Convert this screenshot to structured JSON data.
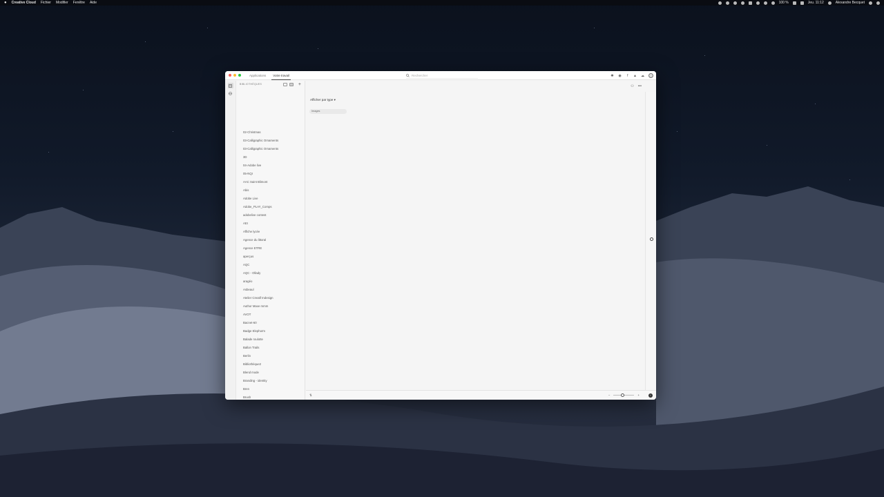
{
  "menubar": {
    "apple": "",
    "app_name": "Creative Cloud",
    "menus": [
      "Fichier",
      "Modifier",
      "Fenêtre",
      "Aide"
    ],
    "battery": "100 %",
    "datetime": "Jeu. 11:12",
    "user": "Alexandre Becquet"
  },
  "window": {
    "tabs": [
      {
        "label": "Applications",
        "active": false
      },
      {
        "label": "Votre travail",
        "active": true
      }
    ],
    "search": {
      "placeholder": "Rechercher"
    },
    "toolbar_icons": [
      "gear-icon",
      "help-icon",
      "font-icon",
      "bell-icon",
      "cloud-icon",
      "avatar-icon"
    ]
  },
  "libraries": {
    "title": "BIBLIOTHÈQUES",
    "items": [
      "02-Christmas",
      "03-Calligraphic Ornaments",
      "03-Calligraphic Ornaments",
      "3D",
      "04-Adobe live",
      "05-NQI",
      "AAC Saint Blimont",
      "Abis",
      "Adobe Live",
      "Adobe_PLAY_Comps",
      "adobelive contest",
      "AEI",
      "Affiche lycée",
      "Agence du littoral",
      "Agence ETRE",
      "aperçus",
      "AQC",
      "AQC - Ollady",
      "aragéo",
      "Asbeaul",
      "Atelier Creatif Indesign",
      "Author Maxe mmm",
      "AVOT",
      "Bacnet-60",
      "Badge Elephorm",
      "Balade roulotte",
      "Ballon Trails",
      "Berlin",
      "Bibliothèque2",
      "Blend mode",
      "Branding - identity",
      "Bren",
      "Brush"
    ]
  },
  "main": {
    "filter_label": "Afficher par type",
    "chip_label": "Images"
  },
  "bottombar": {
    "left_label": "",
    "zoom_level": 0.45
  },
  "colors": {
    "traffic_red": "#fc5f57",
    "traffic_yellow": "#fdbc2e",
    "traffic_green": "#28c840",
    "window_bg": "#f5f5f5"
  }
}
